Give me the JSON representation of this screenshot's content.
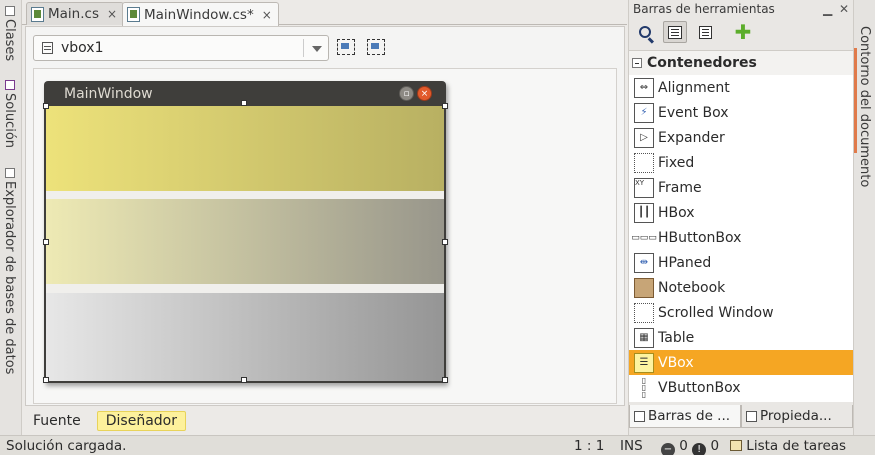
{
  "left_dock": {
    "tabs": [
      "Clases",
      "Solución",
      "Explorador de bases de datos"
    ]
  },
  "right_dock": {
    "tab": "Contorno del documento"
  },
  "doc_tabs": [
    {
      "label": "Main.cs",
      "close": "×",
      "active": false
    },
    {
      "label": "MainWindow.cs*",
      "close": "×",
      "active": true
    }
  ],
  "editor": {
    "widget_selector": "vbox1",
    "gtk_window_title": "MainWindow",
    "bottom_tabs": [
      {
        "label": "Fuente",
        "active": false
      },
      {
        "label": "Diseñador",
        "active": true
      }
    ]
  },
  "toolbox": {
    "title": "Barras de herramientas",
    "category": "Contenedores",
    "items": [
      {
        "label": "Alignment",
        "icon": "alignment-icon"
      },
      {
        "label": "Event Box",
        "icon": "event-box-icon"
      },
      {
        "label": "Expander",
        "icon": "expander-icon"
      },
      {
        "label": "Fixed",
        "icon": "fixed-icon"
      },
      {
        "label": "Frame",
        "icon": "frame-icon"
      },
      {
        "label": "HBox",
        "icon": "hbox-icon"
      },
      {
        "label": "HButtonBox",
        "icon": "hbuttonbox-icon"
      },
      {
        "label": "HPaned",
        "icon": "hpaned-icon"
      },
      {
        "label": "Notebook",
        "icon": "notebook-icon"
      },
      {
        "label": "Scrolled Window",
        "icon": "scrolled-window-icon"
      },
      {
        "label": "Table",
        "icon": "table-icon"
      },
      {
        "label": "VBox",
        "icon": "vbox-icon",
        "selected": true
      },
      {
        "label": "VButtonBox",
        "icon": "vbuttonbox-icon"
      }
    ],
    "footer_tabs": [
      "Barras de ...",
      "Propieda..."
    ],
    "selected_color": "#f5a623"
  },
  "status": {
    "message": "Solución cargada.",
    "position": "1 : 1",
    "mode": "INS",
    "errors": "0",
    "warnings": "0",
    "task_list": "Lista de tareas"
  }
}
